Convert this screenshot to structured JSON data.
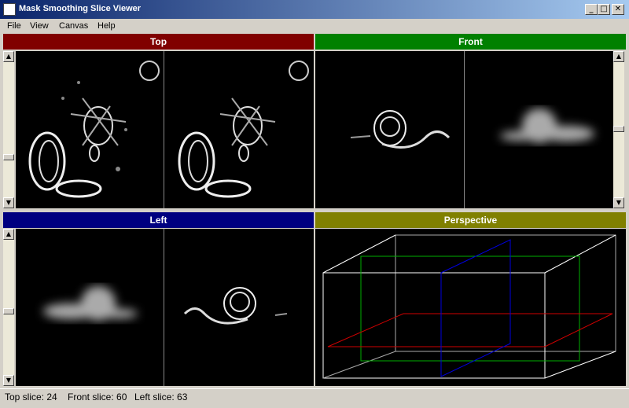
{
  "window": {
    "title": "Mask Smoothing Slice Viewer",
    "minimize": "_",
    "maximize": "□",
    "close": "✕"
  },
  "menu": [
    "File",
    "View",
    "Canvas",
    "Help"
  ],
  "panels": {
    "top": {
      "label": "Top",
      "color": "#800000"
    },
    "front": {
      "label": "Front",
      "color": "#008000"
    },
    "left": {
      "label": "Left",
      "color": "#000080"
    },
    "perspective": {
      "label": "Perspective",
      "color": "#808000"
    }
  },
  "status": {
    "top_slice": "Top slice: 24",
    "front_slice": "Front slice: 60",
    "left_slice": "Left slice: 63"
  },
  "icons": {
    "scroll_up": "▲",
    "scroll_down": "▼"
  }
}
